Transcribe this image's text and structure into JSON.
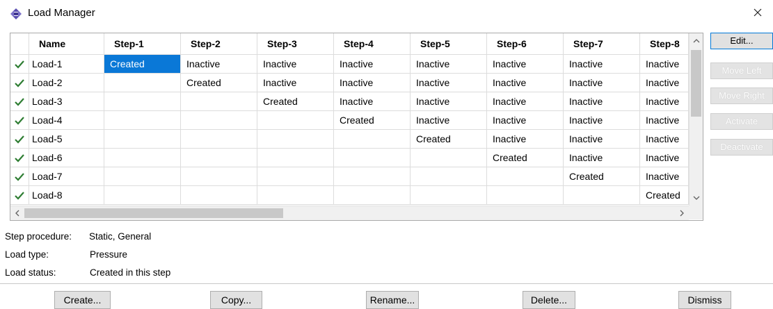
{
  "window": {
    "title": "Load Manager",
    "icon": "load-manager-icon",
    "close_icon": "close-icon"
  },
  "table": {
    "columns": [
      "Name",
      "Step-1",
      "Step-2",
      "Step-3",
      "Step-4",
      "Step-5",
      "Step-6",
      "Step-7",
      "Step-8"
    ],
    "rows": [
      {
        "name": "Load-1",
        "checked": true,
        "cells": [
          "Created",
          "Inactive",
          "Inactive",
          "Inactive",
          "Inactive",
          "Inactive",
          "Inactive",
          "Inactive"
        ]
      },
      {
        "name": "Load-2",
        "checked": true,
        "cells": [
          "",
          "Created",
          "Inactive",
          "Inactive",
          "Inactive",
          "Inactive",
          "Inactive",
          "Inactive"
        ]
      },
      {
        "name": "Load-3",
        "checked": true,
        "cells": [
          "",
          "",
          "Created",
          "Inactive",
          "Inactive",
          "Inactive",
          "Inactive",
          "Inactive"
        ]
      },
      {
        "name": "Load-4",
        "checked": true,
        "cells": [
          "",
          "",
          "",
          "Created",
          "Inactive",
          "Inactive",
          "Inactive",
          "Inactive"
        ]
      },
      {
        "name": "Load-5",
        "checked": true,
        "cells": [
          "",
          "",
          "",
          "",
          "Created",
          "Inactive",
          "Inactive",
          "Inactive"
        ]
      },
      {
        "name": "Load-6",
        "checked": true,
        "cells": [
          "",
          "",
          "",
          "",
          "",
          "Created",
          "Inactive",
          "Inactive"
        ]
      },
      {
        "name": "Load-7",
        "checked": true,
        "cells": [
          "",
          "",
          "",
          "",
          "",
          "",
          "Created",
          "Inactive"
        ]
      },
      {
        "name": "Load-8",
        "checked": true,
        "cells": [
          "",
          "",
          "",
          "",
          "",
          "",
          "",
          "Created"
        ]
      }
    ],
    "selected": {
      "row": 0,
      "col": 0
    },
    "check_color": "#2e7d32",
    "selection_color": "#0a78d7"
  },
  "side_buttons": {
    "edit": "Edit...",
    "move_left": "Move Left",
    "move_right": "Move Right",
    "activate": "Activate",
    "deactivate": "Deactivate"
  },
  "info": {
    "step_procedure_label": "Step procedure:",
    "step_procedure_value": "Static, General",
    "load_type_label": "Load type:",
    "load_type_value": "Pressure",
    "load_status_label": "Load status:",
    "load_status_value": "Created in this step"
  },
  "bottom_buttons": {
    "create": "Create...",
    "copy": "Copy...",
    "rename": "Rename...",
    "delete": "Delete...",
    "dismiss": "Dismiss"
  }
}
